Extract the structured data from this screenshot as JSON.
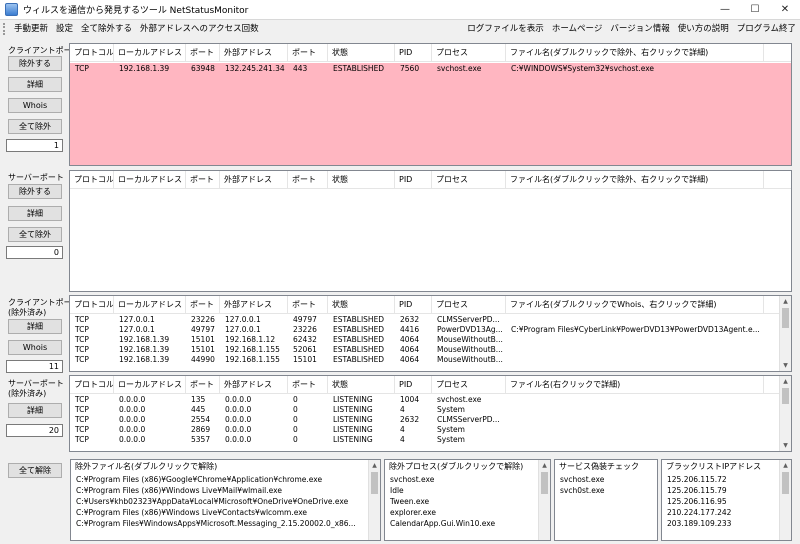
{
  "window": {
    "title": "ウィルスを通信から発見するツール NetStatusMonitor",
    "minimize": "—",
    "maximize": "☐",
    "close": "✕"
  },
  "menu": {
    "left": [
      "手動更新",
      "設定",
      "全て除外する",
      "外部アドレスへのアクセス回数"
    ],
    "right": [
      "ログファイルを表示",
      "ホームページ",
      "バージョン情報",
      "使い方の説明",
      "プログラム終了"
    ]
  },
  "client_port": {
    "label": "クライアントポート",
    "exclude_button": "除外する",
    "detail_button": "詳細",
    "whois_button": "Whois",
    "exclude_all_button": "全て除外",
    "count": "1",
    "columns": [
      "プロトコル",
      "ローカルアドレス",
      "ポート",
      "外部アドレス",
      "ポート",
      "状態",
      "PID",
      "プロセス",
      "ファイル名(ダブルクリックで除外、右クリックで詳細)"
    ],
    "rows": [
      [
        "TCP",
        "192.168.1.39",
        "63948",
        "132.245.241.34",
        "443",
        "ESTABLISHED",
        "7560",
        "svchost.exe",
        "C:¥WINDOWS¥System32¥svchost.exe"
      ]
    ]
  },
  "server_port": {
    "label": "サーバーポート",
    "exclude_button": "除外する",
    "detail_button": "詳細",
    "exclude_all_button": "全て除外",
    "count": "0",
    "columns": [
      "プロトコル",
      "ローカルアドレス",
      "ポート",
      "外部アドレス",
      "ポート",
      "状態",
      "PID",
      "プロセス",
      "ファイル名(ダブルクリックで除外、右クリックで詳細)"
    ],
    "rows": []
  },
  "client_port_excluded": {
    "label_line1": "クライアントポート",
    "label_line2": "(除外済み)",
    "detail_button": "詳細",
    "whois_button": "Whois",
    "count": "11",
    "columns": [
      "プロトコル",
      "ローカルアドレス",
      "ポート",
      "外部アドレス",
      "ポート",
      "状態",
      "PID",
      "プロセス",
      "ファイル名(ダブルクリックでWhois、右クリックで詳細)"
    ],
    "rows": [
      [
        "TCP",
        "127.0.0.1",
        "23226",
        "127.0.0.1",
        "49797",
        "ESTABLISHED",
        "2632",
        "CLMSServerPD...",
        ""
      ],
      [
        "TCP",
        "127.0.0.1",
        "49797",
        "127.0.0.1",
        "23226",
        "ESTABLISHED",
        "4416",
        "PowerDVD13Ag...",
        "C:¥Program Files¥CyberLink¥PowerDVD13¥PowerDVD13Agent.e..."
      ],
      [
        "TCP",
        "192.168.1.39",
        "15101",
        "192.168.1.12",
        "62432",
        "ESTABLISHED",
        "4064",
        "MouseWithoutB...",
        ""
      ],
      [
        "TCP",
        "192.168.1.39",
        "15101",
        "192.168.1.155",
        "52061",
        "ESTABLISHED",
        "4064",
        "MouseWithoutB...",
        ""
      ],
      [
        "TCP",
        "192.168.1.39",
        "44990",
        "192.168.1.155",
        "15101",
        "ESTABLISHED",
        "4064",
        "MouseWithoutB...",
        ""
      ]
    ]
  },
  "server_port_excluded": {
    "label_line1": "サーバーポート",
    "label_line2": "(除外済み)",
    "detail_button": "詳細",
    "count": "20",
    "columns": [
      "プロトコル",
      "ローカルアドレス",
      "ポート",
      "外部アドレス",
      "ポート",
      "状態",
      "PID",
      "プロセス",
      "ファイル名(右クリックで詳細)"
    ],
    "rows": [
      [
        "TCP",
        "0.0.0.0",
        "135",
        "0.0.0.0",
        "0",
        "LISTENING",
        "1004",
        "svchost.exe",
        ""
      ],
      [
        "TCP",
        "0.0.0.0",
        "445",
        "0.0.0.0",
        "0",
        "LISTENING",
        "4",
        "System",
        ""
      ],
      [
        "TCP",
        "0.0.0.0",
        "2554",
        "0.0.0.0",
        "0",
        "LISTENING",
        "2632",
        "CLMSServerPD...",
        ""
      ],
      [
        "TCP",
        "0.0.0.0",
        "2869",
        "0.0.0.0",
        "0",
        "LISTENING",
        "4",
        "System",
        ""
      ],
      [
        "TCP",
        "0.0.0.0",
        "5357",
        "0.0.0.0",
        "0",
        "LISTENING",
        "4",
        "System",
        ""
      ]
    ]
  },
  "bottom": {
    "clear_all_button": "全て解除",
    "excluded_files": {
      "header": "除外ファイル名(ダブルクリックで解除)",
      "items": [
        "C:¥Program Files (x86)¥Google¥Chrome¥Application¥chrome.exe",
        "C:¥Program Files (x86)¥Windows Live¥Mail¥wlmail.exe",
        "C:¥Users¥khb02323¥AppData¥Local¥Microsoft¥OneDrive¥OneDrive.exe",
        "C:¥Program Files (x86)¥Windows Live¥Contacts¥wlcomm.exe",
        "C:¥Program Files¥WindowsApps¥Microsoft.Messaging_2.15.20002.0_x86..."
      ]
    },
    "excluded_processes": {
      "header": "除外プロセス(ダブルクリックで解除)",
      "items": [
        "svchost.exe",
        "Idle",
        "Tween.exe",
        "explorer.exe",
        "CalendarApp.Gui.Win10.exe"
      ]
    },
    "service_check": {
      "header": "サービス偽装チェック",
      "items": [
        "svchost.exe",
        "svch0st.exe"
      ]
    },
    "blacklist": {
      "header": "ブラックリストIPアドレス",
      "items": [
        "125.206.115.72",
        "125.206.115.79",
        "125.206.116.95",
        "210.224.177.242",
        "203.189.109.233"
      ]
    }
  }
}
